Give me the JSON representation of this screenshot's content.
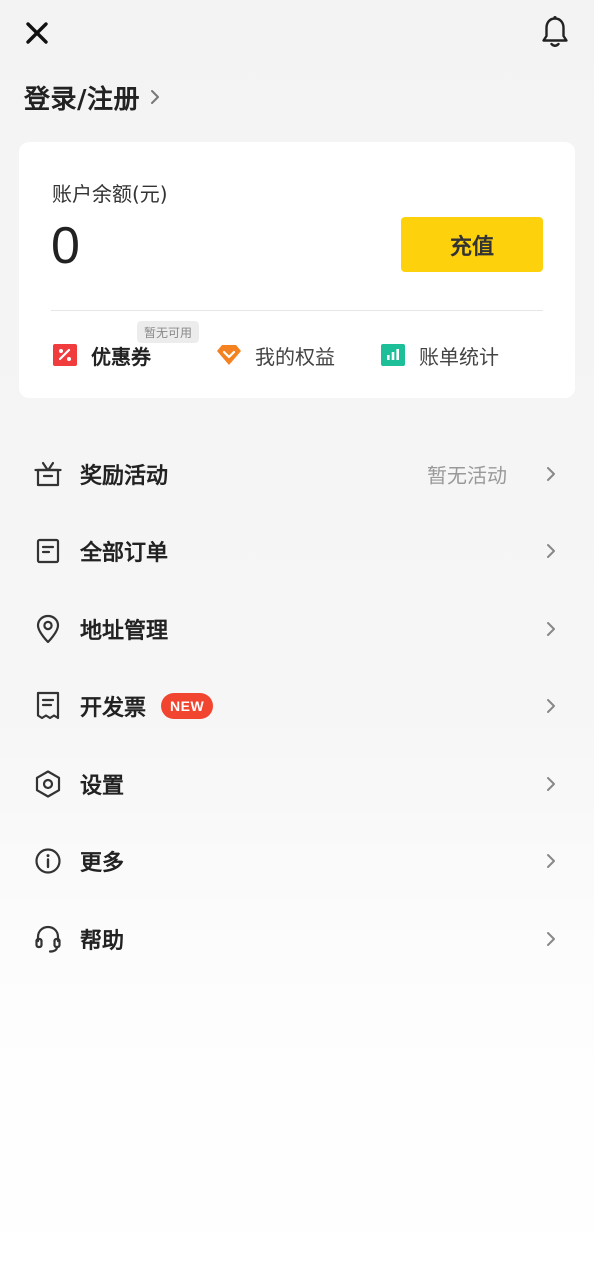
{
  "header": {
    "close_icon": "close-icon",
    "bell_icon": "bell-icon",
    "login_label": "登录/注册"
  },
  "account": {
    "balance_label": "账户余额(元)",
    "balance_value": "0",
    "recharge_label": "充值",
    "recharge_color": "#fdd20d"
  },
  "shortcuts": {
    "coupon": {
      "label": "优惠券",
      "tag": "暂无可用",
      "icon": "coupon-icon",
      "color": "#f03c3c"
    },
    "rights": {
      "label": "我的权益",
      "icon": "diamond-icon",
      "color": "#f58220"
    },
    "bills": {
      "label": "账单统计",
      "icon": "bar-chart-icon",
      "color": "#1cbf98"
    }
  },
  "menu": {
    "items": [
      {
        "label": "奖励活动",
        "sub": "暂无活动",
        "icon": "gift-icon"
      },
      {
        "label": "全部订单",
        "icon": "order-icon"
      },
      {
        "label": "地址管理",
        "icon": "location-pin-icon"
      },
      {
        "label": "开发票",
        "badge": "NEW",
        "icon": "invoice-icon"
      },
      {
        "label": "设置",
        "icon": "settings-hexagon-icon"
      },
      {
        "label": "更多",
        "icon": "info-icon"
      },
      {
        "label": "帮助",
        "icon": "headset-icon"
      }
    ]
  },
  "colors": {
    "badge_new": "#f2452f",
    "background": "#f5f5f5"
  }
}
